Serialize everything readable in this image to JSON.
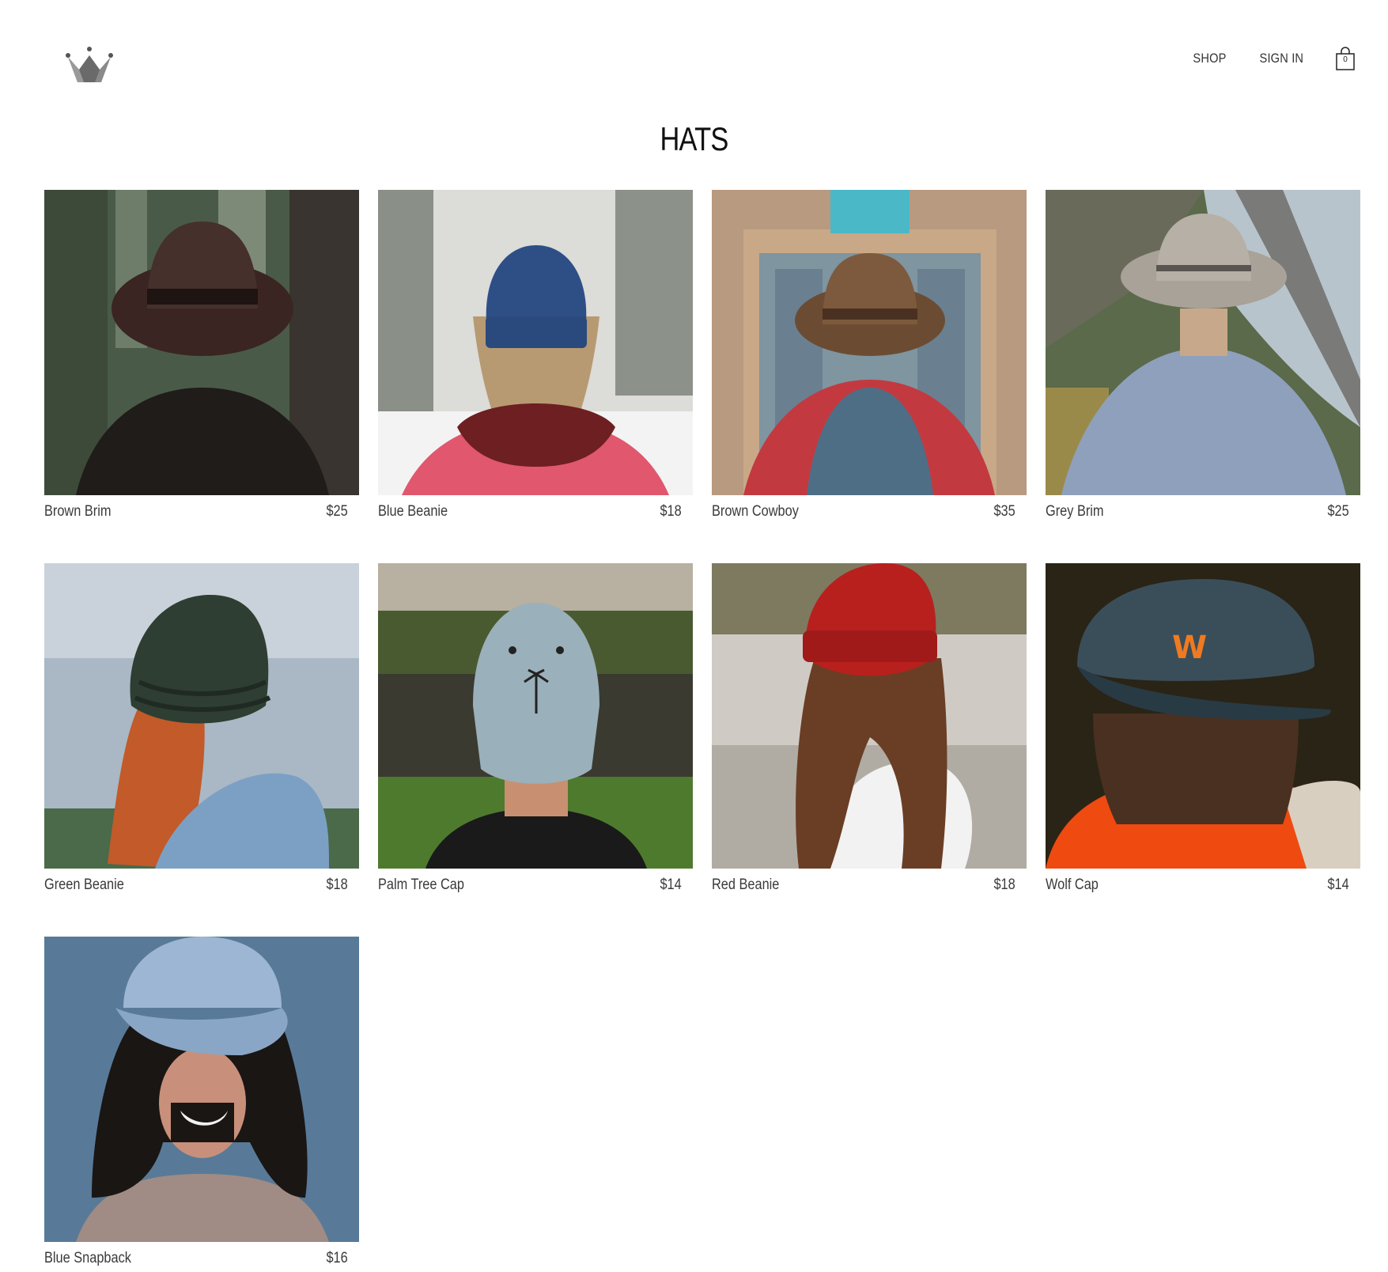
{
  "header": {
    "logo_icon": "crown-icon",
    "nav": [
      {
        "label": "SHOP"
      },
      {
        "label": "SIGN IN"
      }
    ],
    "cart": {
      "icon": "shopping-bag-icon",
      "count": "0"
    }
  },
  "page": {
    "title": "HATS"
  },
  "products": [
    {
      "name": "Brown Brim",
      "price": "$25"
    },
    {
      "name": "Blue Beanie",
      "price": "$18"
    },
    {
      "name": "Brown Cowboy",
      "price": "$35"
    },
    {
      "name": "Grey Brim",
      "price": "$25"
    },
    {
      "name": "Green Beanie",
      "price": "$18"
    },
    {
      "name": "Palm Tree Cap",
      "price": "$14"
    },
    {
      "name": "Red Beanie",
      "price": "$18"
    },
    {
      "name": "Wolf Cap",
      "price": "$14"
    },
    {
      "name": "Blue Snapback",
      "price": "$16"
    }
  ]
}
